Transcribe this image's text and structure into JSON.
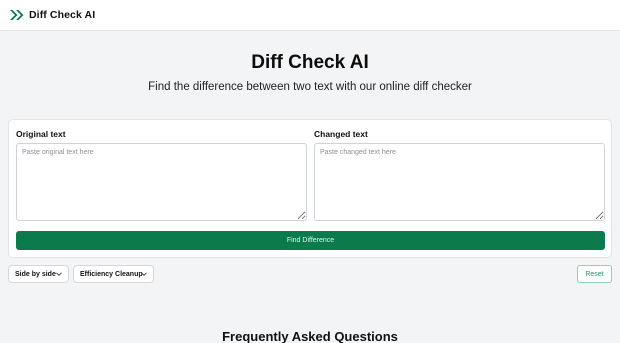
{
  "header": {
    "brand": "Diff Check AI",
    "logo_icon": "double-chevron-right-icon",
    "logo_color": "#0b7a4c"
  },
  "hero": {
    "title": "Diff Check AI",
    "subtitle": "Find the difference between two text with our online diff checker"
  },
  "editor": {
    "original_label": "Original text",
    "original_placeholder": "Paste original text here",
    "original_value": "",
    "changed_label": "Changed text",
    "changed_placeholder": "Paste changed text here",
    "changed_value": "",
    "find_button": "Find Difference",
    "accent": "#0b7a4c"
  },
  "controls": {
    "view_select": "Side by side",
    "cleanup_select": "Efficiency Cleanup",
    "reset_button": "Reset"
  },
  "faq": {
    "title": "Frequently Asked Questions"
  }
}
